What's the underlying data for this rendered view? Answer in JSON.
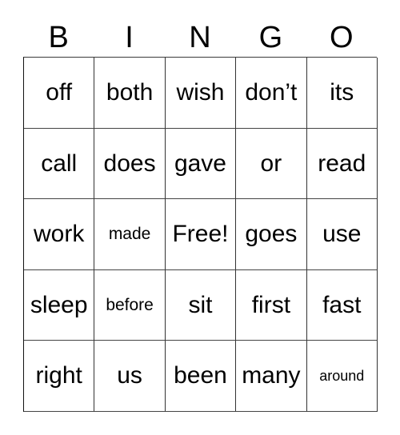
{
  "card": {
    "header": {
      "letters": [
        "B",
        "I",
        "N",
        "G",
        "O"
      ]
    },
    "grid": {
      "rows": [
        {
          "cells": [
            {
              "text": "off",
              "size": "normal"
            },
            {
              "text": "both",
              "size": "normal"
            },
            {
              "text": "wish",
              "size": "normal"
            },
            {
              "text": "don’t",
              "size": "normal"
            },
            {
              "text": "its",
              "size": "normal"
            }
          ]
        },
        {
          "cells": [
            {
              "text": "call",
              "size": "normal"
            },
            {
              "text": "does",
              "size": "normal"
            },
            {
              "text": "gave",
              "size": "normal"
            },
            {
              "text": "or",
              "size": "normal"
            },
            {
              "text": "read",
              "size": "normal"
            }
          ]
        },
        {
          "cells": [
            {
              "text": "work",
              "size": "normal"
            },
            {
              "text": "made",
              "size": "small"
            },
            {
              "text": "Free!",
              "size": "normal"
            },
            {
              "text": "goes",
              "size": "normal"
            },
            {
              "text": "use",
              "size": "normal"
            }
          ]
        },
        {
          "cells": [
            {
              "text": "sleep",
              "size": "normal"
            },
            {
              "text": "before",
              "size": "small"
            },
            {
              "text": "sit",
              "size": "normal"
            },
            {
              "text": "first",
              "size": "normal"
            },
            {
              "text": "fast",
              "size": "normal"
            }
          ]
        },
        {
          "cells": [
            {
              "text": "right",
              "size": "normal"
            },
            {
              "text": "us",
              "size": "normal"
            },
            {
              "text": "been",
              "size": "normal"
            },
            {
              "text": "many",
              "size": "normal"
            },
            {
              "text": "around",
              "size": "extra-small"
            }
          ]
        }
      ]
    },
    "colors": {
      "background": "#ffffff",
      "text": "#000000",
      "grid_line": "#333333"
    }
  }
}
